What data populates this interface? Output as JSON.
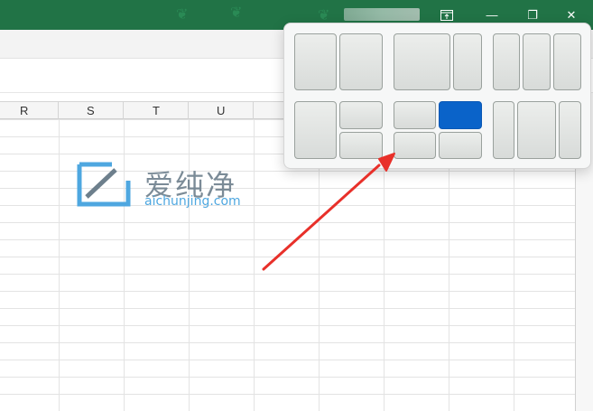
{
  "window": {
    "title_bar_color": "#217346",
    "controls": {
      "snap_icon": "snap-layout-icon",
      "minimize_glyph": "—",
      "restore_glyph": "❐",
      "close_glyph": "✕"
    }
  },
  "sheet": {
    "columns": [
      "R",
      "S",
      "T",
      "U"
    ]
  },
  "watermark": {
    "chinese": "爱纯净",
    "url": "aichunjing.com"
  },
  "snap_layouts": {
    "active_color": "#0a63c9",
    "groups": [
      {
        "name": "two-columns",
        "zones": 2
      },
      {
        "name": "wide-left-narrow-right",
        "zones": 2
      },
      {
        "name": "three-columns",
        "zones": 3
      },
      {
        "name": "left-half-right-split",
        "zones": 3
      },
      {
        "name": "four-quadrants",
        "zones": 4,
        "active_zone": "top-right"
      },
      {
        "name": "three-columns-wide-center",
        "zones": 3
      }
    ]
  },
  "annotation": {
    "arrow_color": "#e8302a"
  }
}
